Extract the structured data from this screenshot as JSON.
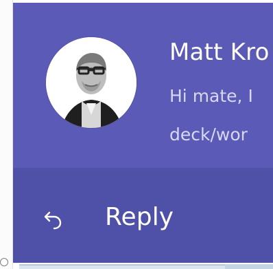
{
  "notification": {
    "sender": "Matt Kro",
    "preview_lines": [
      "Hi mate, I",
      "deck/wor"
    ],
    "avatar_icon": "person-avatar",
    "reply_label": "Reply",
    "reply_icon": "reply-arrow-icon"
  },
  "colors": {
    "toast_top": "#5b5ab7",
    "toast_bottom": "#4f50a8",
    "text_primary": "#ffffff",
    "text_secondary": "#d7d8f2"
  }
}
